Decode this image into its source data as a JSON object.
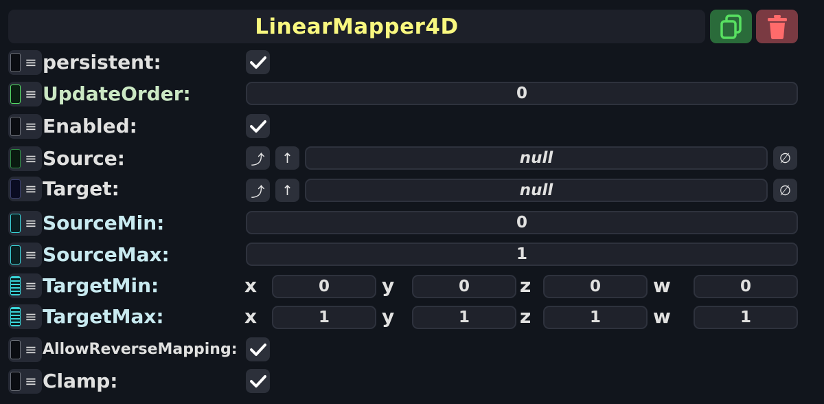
{
  "header": {
    "title": "LinearMapper4D",
    "duplicate_icon": "duplicate-icon",
    "delete_icon": "trash-icon"
  },
  "fields": {
    "persistent": {
      "label": "persistent:",
      "checked": true
    },
    "update_order": {
      "label": "UpdateOrder:",
      "value": "0"
    },
    "enabled": {
      "label": "Enabled:",
      "checked": true
    },
    "source": {
      "label": "Source:",
      "value": "null",
      "open_glyph": "⤴",
      "up_glyph": "↑",
      "clear_glyph": "∅"
    },
    "target": {
      "label": "Target:",
      "value": "null",
      "open_glyph": "⤴",
      "up_glyph": "↑",
      "clear_glyph": "∅"
    },
    "source_min": {
      "label": "SourceMin:",
      "value": "0"
    },
    "source_max": {
      "label": "SourceMax:",
      "value": "1"
    },
    "target_min": {
      "label": "TargetMin:",
      "x_label": "x",
      "x": "0",
      "y_label": "y",
      "y": "0",
      "z_label": "z",
      "z": "0",
      "w_label": "w",
      "w": "0"
    },
    "target_max": {
      "label": "TargetMax:",
      "x_label": "x",
      "x": "1",
      "y_label": "y",
      "y": "1",
      "z_label": "z",
      "z": "1",
      "w_label": "w",
      "w": "1"
    },
    "allow_reverse_mapping": {
      "label": "AllowReverseMapping:",
      "checked": true
    },
    "clamp": {
      "label": "Clamp:",
      "checked": true
    }
  },
  "menu_glyph": "≡",
  "colors": {
    "title": "#f8f77f",
    "background": "#11151c",
    "duplicate": "#2a6b3a",
    "delete": "#7a3a42"
  }
}
